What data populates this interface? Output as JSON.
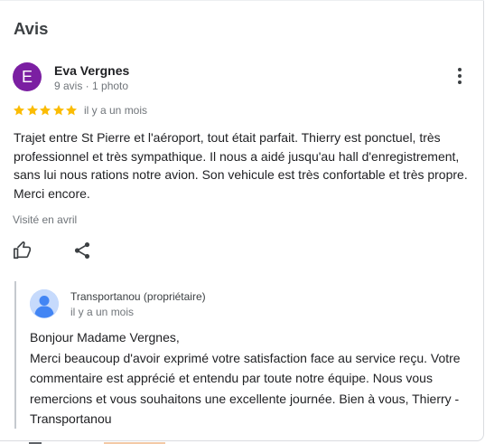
{
  "section_title": "Avis",
  "review": {
    "avatar_letter": "E",
    "reviewer_name": "Eva Vergnes",
    "reviewer_meta": "9 avis · 1 photo",
    "rating": 5,
    "rating_max": 5,
    "date": "il y a un mois",
    "text": "Trajet entre St Pierre et l'aéroport, tout était parfait. Thierry est ponctuel, très professionnel et très sympathique. Il nous a aidé jusqu'au hall d'enregistrement, sans lui nous rations notre avion. Son vehicule est très confortable et très propre. Merci encore.",
    "visited": "Visité en avril"
  },
  "actions": {
    "like_icon": "thumb-up-icon",
    "share_icon": "share-icon",
    "more_icon": "more-vert-icon"
  },
  "owner_reply": {
    "name": "Transportanou (propriétaire)",
    "date": "il y a un mois",
    "lines": [
      "Bonjour Madame Vergnes,",
      "Merci beaucoup d'avoir exprimé votre satisfaction face au service reçu. Votre",
      "commentaire est apprécié et entendu par toute notre équipe. Nous vous",
      "remercions et vous souhaitons une excellente journée. Bien à vous, Thierry -",
      "Transportanou"
    ]
  },
  "colors": {
    "avatar_bg": "#7b1fa2",
    "star": "#fbbc04",
    "owner_avatar_bg": "#aecbfa"
  }
}
